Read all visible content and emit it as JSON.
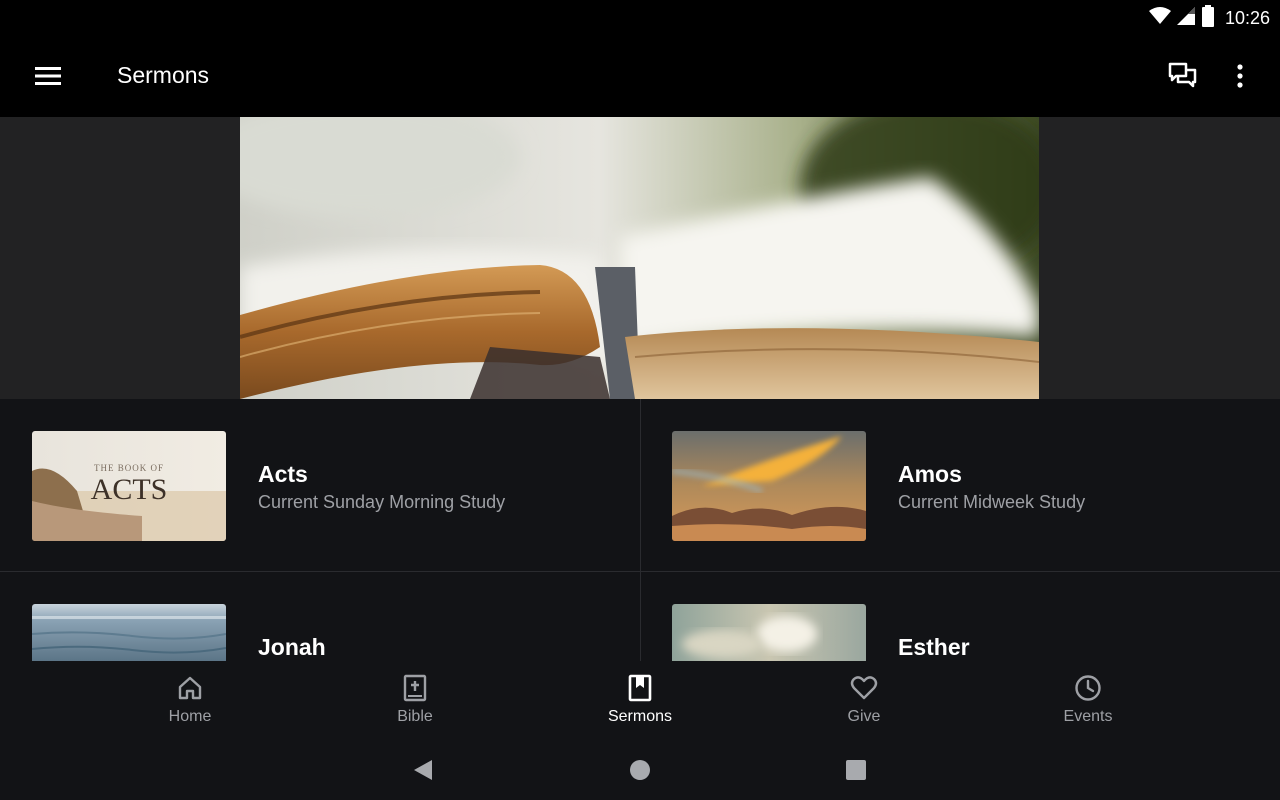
{
  "status_bar": {
    "time": "10:26",
    "icons": [
      "wifi-icon",
      "signal-icon",
      "battery-icon"
    ]
  },
  "app_bar": {
    "title": "Sermons",
    "icons": [
      "menu-icon",
      "chat-icon",
      "more-vert-icon"
    ]
  },
  "colors": {
    "background": "#121316",
    "hero_band": "#222223",
    "text_secondary": "#9ea0a5",
    "active": "#ffffff"
  },
  "series": [
    {
      "title": "Acts",
      "subtitle": "Current Sunday Morning Study",
      "thumb_text_small": "THE BOOK OF",
      "thumb_text_big": "ACTS"
    },
    {
      "title": "Amos",
      "subtitle": "Current Midweek Study"
    },
    {
      "title": "Jonah"
    },
    {
      "title": "Esther"
    }
  ],
  "bottom_nav": {
    "items": [
      {
        "label": "Home",
        "icon": "home-icon",
        "active": false
      },
      {
        "label": "Bible",
        "icon": "bible-icon",
        "active": false
      },
      {
        "label": "Sermons",
        "icon": "bookmark-book-icon",
        "active": true
      },
      {
        "label": "Give",
        "icon": "heart-icon",
        "active": false
      },
      {
        "label": "Events",
        "icon": "clock-icon",
        "active": false
      }
    ]
  }
}
